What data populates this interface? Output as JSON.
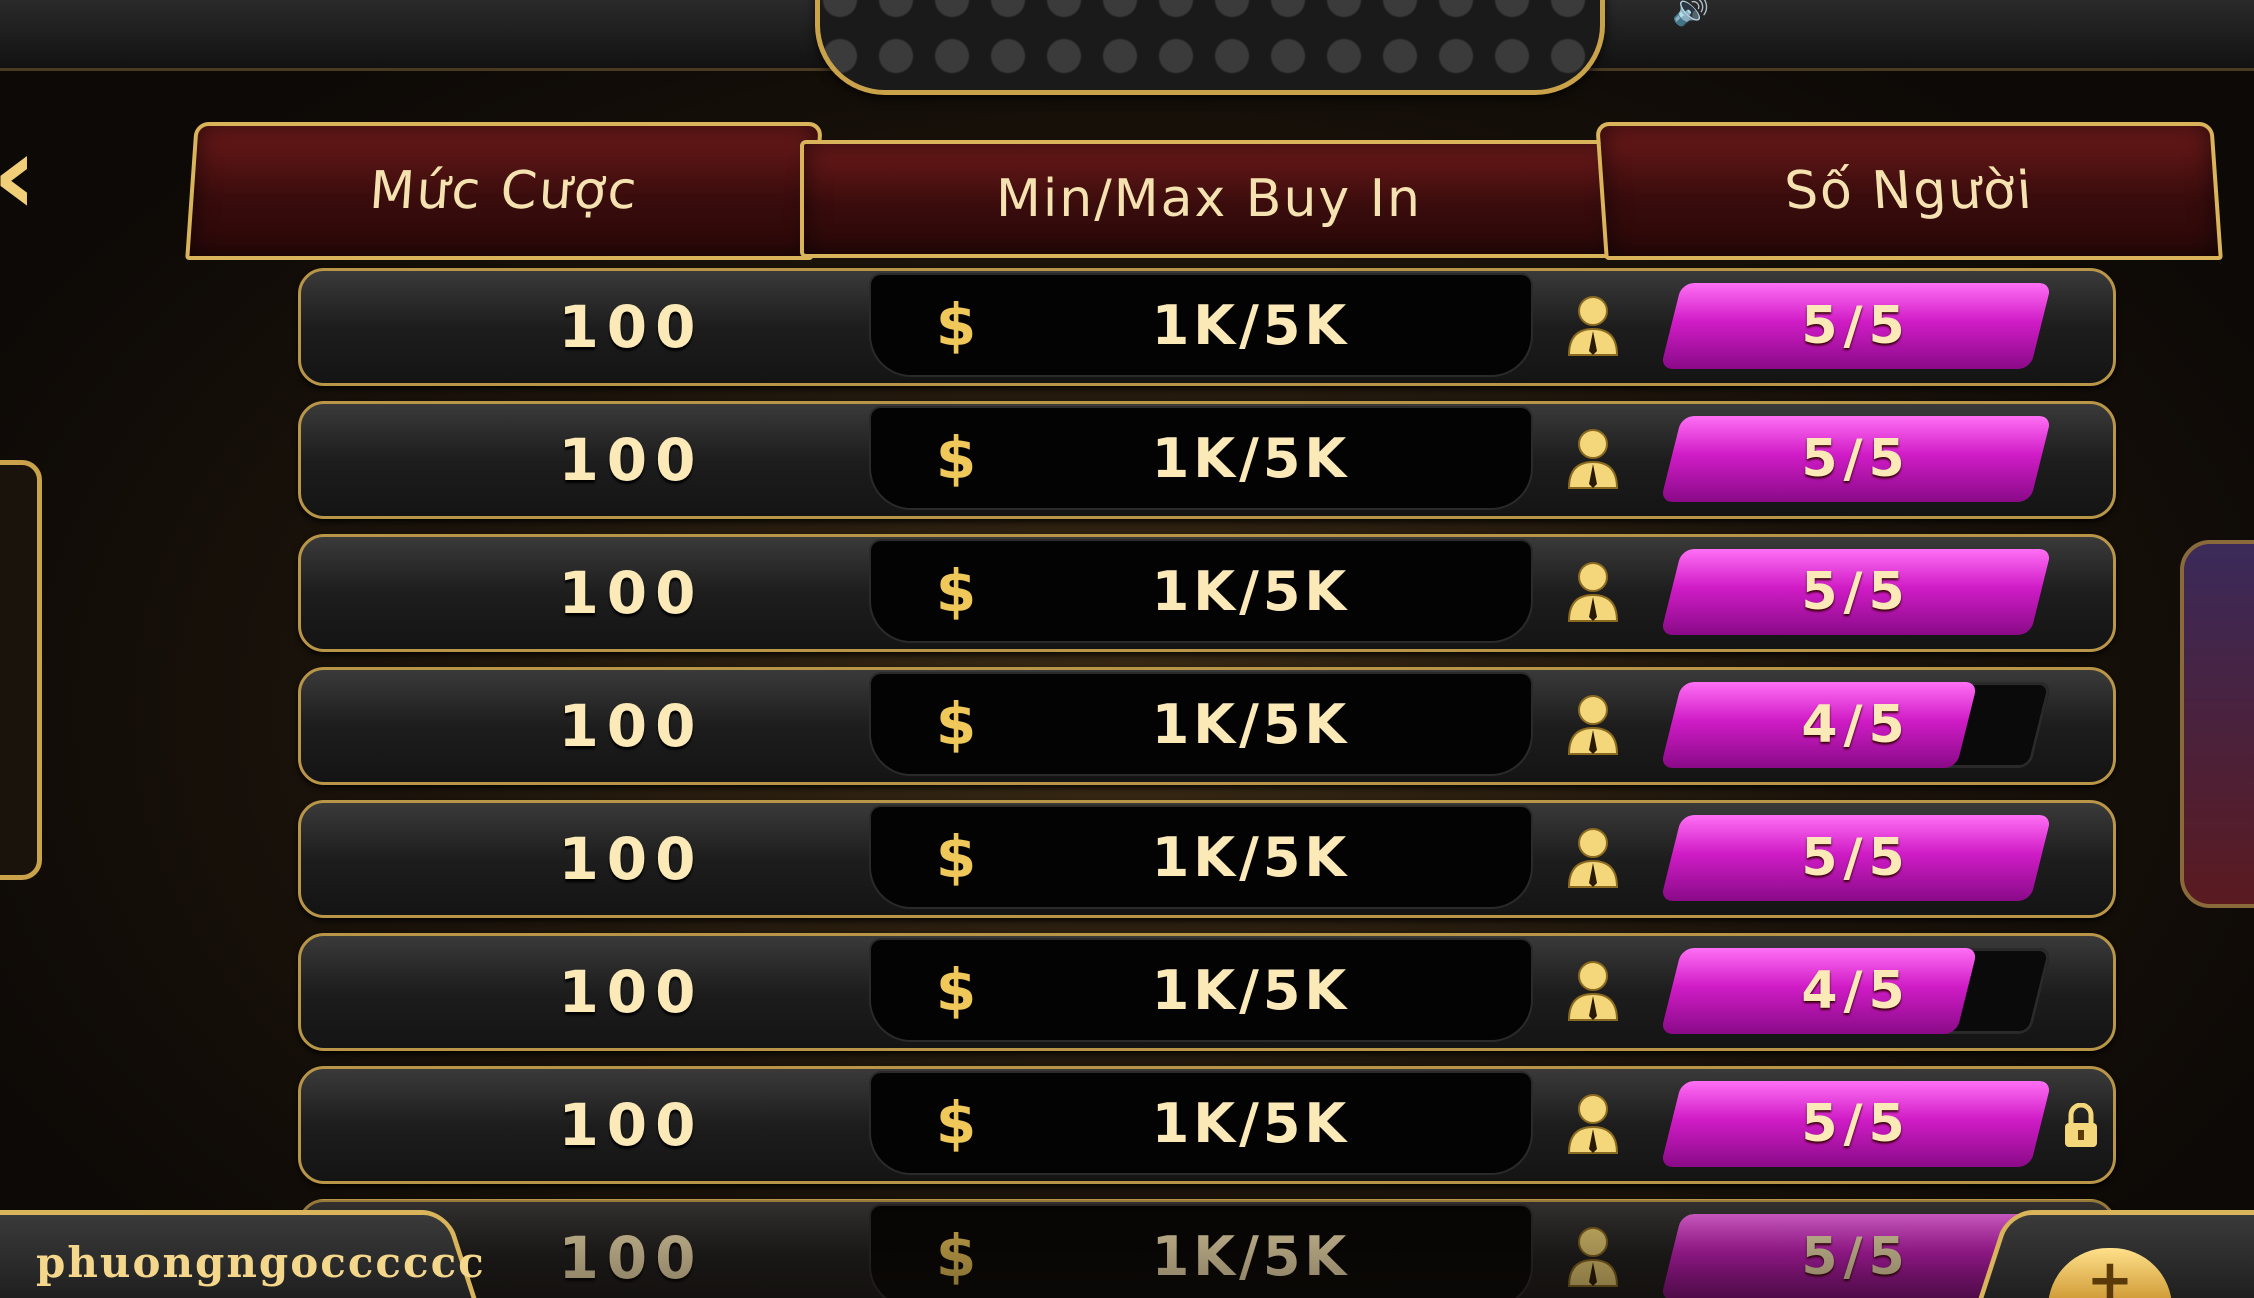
{
  "headers": {
    "bet": "Mức Cược",
    "buyin": "Min/Max Buy In",
    "players": "Số Người"
  },
  "currency_symbol": "$",
  "rows": [
    {
      "bet": "100",
      "buyin": "1K/5K",
      "players": "5/5",
      "fill": 1.0,
      "locked": false
    },
    {
      "bet": "100",
      "buyin": "1K/5K",
      "players": "5/5",
      "fill": 1.0,
      "locked": false
    },
    {
      "bet": "100",
      "buyin": "1K/5K",
      "players": "5/5",
      "fill": 1.0,
      "locked": false
    },
    {
      "bet": "100",
      "buyin": "1K/5K",
      "players": "4/5",
      "fill": 0.8,
      "locked": false
    },
    {
      "bet": "100",
      "buyin": "1K/5K",
      "players": "5/5",
      "fill": 1.0,
      "locked": false
    },
    {
      "bet": "100",
      "buyin": "1K/5K",
      "players": "4/5",
      "fill": 0.8,
      "locked": false
    },
    {
      "bet": "100",
      "buyin": "1K/5K",
      "players": "5/5",
      "fill": 1.0,
      "locked": true
    },
    {
      "bet": "100",
      "buyin": "1K/5K",
      "players": "5/5",
      "fill": 1.0,
      "locked": false
    }
  ],
  "user": {
    "name": "phuongngocccccc"
  },
  "icons": {
    "back": "back-chevron-icon",
    "sound": "speaker-icon",
    "currency": "dollar-icon",
    "player": "user-icon",
    "lock": "lock-icon",
    "add": "plus-icon"
  },
  "colors": {
    "gold": "#d9b45a",
    "header_red": "#6e1a1a",
    "bar_magenta": "#d01cc6",
    "text_cream": "#fbe9b8"
  }
}
